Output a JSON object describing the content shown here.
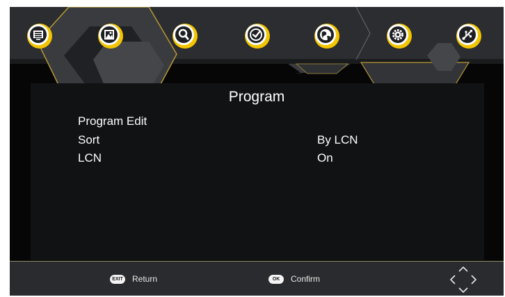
{
  "nav": {
    "icons": [
      "tv-program-icon",
      "picture-icon",
      "search-icon",
      "clock-icon",
      "globe-icon",
      "settings-icon",
      "usb-icon"
    ]
  },
  "page": {
    "title": "Program"
  },
  "menu": {
    "items": [
      {
        "label": "Program Edit",
        "value": ""
      },
      {
        "label": "Sort",
        "value": "By LCN"
      },
      {
        "label": "LCN",
        "value": "On"
      }
    ]
  },
  "footer": {
    "return_key": "EXIT",
    "return_label": "Return",
    "confirm_key": "OK",
    "confirm_label": "Confirm"
  },
  "colors": {
    "accent": "#f3c400",
    "background": "#060607",
    "panel": "#111214",
    "footer": "#2a2b2e"
  }
}
